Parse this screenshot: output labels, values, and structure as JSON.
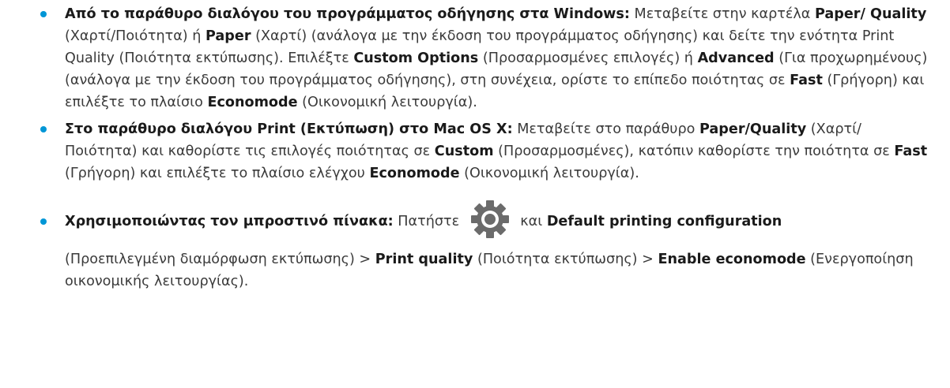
{
  "item1": {
    "lead": "Από το παράθυρο διαλόγου του προγράμματος οδήγησης στα Windows:",
    "t1": " Μεταβείτε στην καρτέλα ",
    "b1": "Paper/ Quality",
    "t2": " (Χαρτί/Ποιότητα) ή ",
    "b2": "Paper",
    "t3": " (Χαρτί) (ανάλογα με την έκδοση του προγράμματος οδήγησης) και δείτε την ενότητα Print Quality (Ποιότητα εκτύπωσης). Επιλέξτε ",
    "b3": "Custom Options",
    "t4": " (Προσαρμοσμένες επιλογές) ή ",
    "b4": "Advanced",
    "t5": " (Για προχωρημένους) (ανάλογα με την έκδοση του προγράμματος οδήγησης), στη συνέχεια, ορίστε το επίπεδο ποιότητας σε ",
    "b5": "Fast",
    "t6": " (Γρήγορη) και επιλέξτε το πλαίσιο ",
    "b6": "Economode",
    "t7": " (Οικονομική λειτουργία)."
  },
  "item2": {
    "lead": "Στο παράθυρο διαλόγου Print (Εκτύπωση) στο Mac OS X:",
    "t1": " Μεταβείτε στο παράθυρο ",
    "b1": "Paper/Quality",
    "t2": " (Χαρτί/ Ποιότητα) και καθορίστε τις επιλογές ποιότητας σε ",
    "b2": "Custom",
    "t3": " (Προσαρμοσμένες), κατόπιν καθορίστε την ποιότητα σε ",
    "b3": "Fast",
    "t4": " (Γρήγορη) και επιλέξτε το πλαίσιο ελέγχου ",
    "b4": "Economode",
    "t5": " (Οικονομική λειτουργία)."
  },
  "item3": {
    "lead": "Χρησιμοποιώντας τον μπροστινό πίνακα:",
    "t1": " Πατήστε ",
    "icon": "gear-icon",
    "t2": " και ",
    "b1": "Default printing configuration",
    "t3": " (Προεπιλεγμένη διαμόρφωση εκτύπωσης) > ",
    "b2": "Print quality",
    "t4": " (Ποιότητα εκτύπωσης) > ",
    "b3": "Enable economode",
    "t5": " (Ενεργοποίηση οικονομικής λειτουργίας)."
  },
  "colors": {
    "bullet": "#0096d6",
    "gear": "#6b6b6b"
  }
}
